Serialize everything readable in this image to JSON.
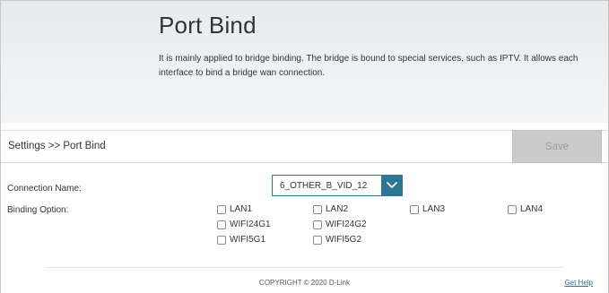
{
  "header": {
    "title": "Port Bind",
    "description": "It is mainly applied to bridge binding. The bridge is bound to special services, such as IPTV. It allows each interface to bind a bridge wan connection."
  },
  "toolbar": {
    "breadcrumb": "Settings >> Port Bind",
    "save_label": "Save"
  },
  "form": {
    "connection_label": "Connection Name:",
    "connection_value": "6_OTHER_B_VID_12",
    "binding_label": "Binding Option:",
    "options": [
      {
        "label": "LAN1",
        "checked": false
      },
      {
        "label": "LAN2",
        "checked": false
      },
      {
        "label": "LAN3",
        "checked": false
      },
      {
        "label": "LAN4",
        "checked": false
      },
      {
        "label": "WIFI24G1",
        "checked": false
      },
      {
        "label": "WIFI24G2",
        "checked": false
      },
      {
        "label": "WIFI5G1",
        "checked": false
      },
      {
        "label": "WIFI5G2",
        "checked": false
      }
    ]
  },
  "footer": {
    "copyright": "COPYRIGHT © 2020 D-Link",
    "help": "Get Help"
  },
  "colors": {
    "accent": "#2f7596",
    "save_disabled_bg": "#cbcbcb",
    "link": "#2a6fa0"
  },
  "icons": {
    "dropdown": "chevron-down-icon"
  }
}
